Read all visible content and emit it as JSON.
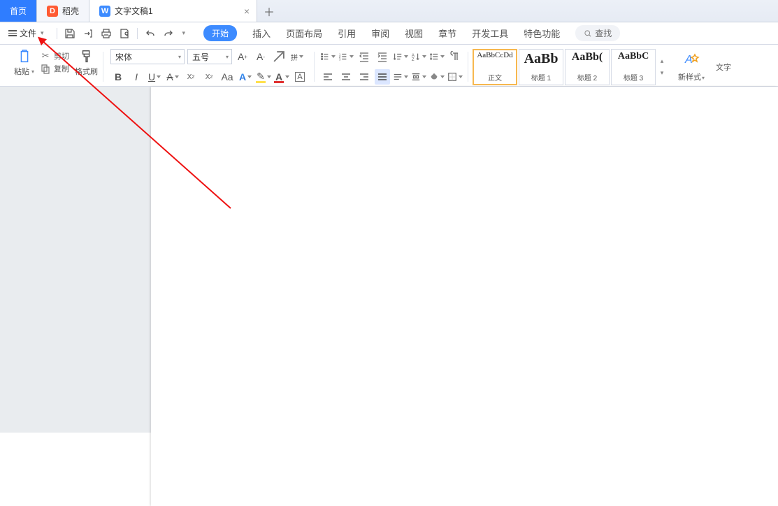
{
  "tabs": {
    "home": "首页",
    "secondary": "稻壳",
    "doc": "文字文稿1"
  },
  "menu": {
    "file": "文件"
  },
  "ribbon_tabs": [
    "开始",
    "插入",
    "页面布局",
    "引用",
    "审阅",
    "视图",
    "章节",
    "开发工具",
    "特色功能"
  ],
  "search_label": "查找",
  "clipboard": {
    "paste": "粘贴",
    "cut": "剪切",
    "copy": "复制",
    "format_painter": "格式刷"
  },
  "font": {
    "name": "宋体",
    "size": "五号"
  },
  "styles": [
    {
      "preview": "AaBbCcDd",
      "label": "正文"
    },
    {
      "preview": "AaBb",
      "label": "标题 1"
    },
    {
      "preview": "AaBb(",
      "label": "标题 2"
    },
    {
      "preview": "AaBbC",
      "label": "标题 3"
    }
  ],
  "new_style": "新样式",
  "text_tool": "文字"
}
